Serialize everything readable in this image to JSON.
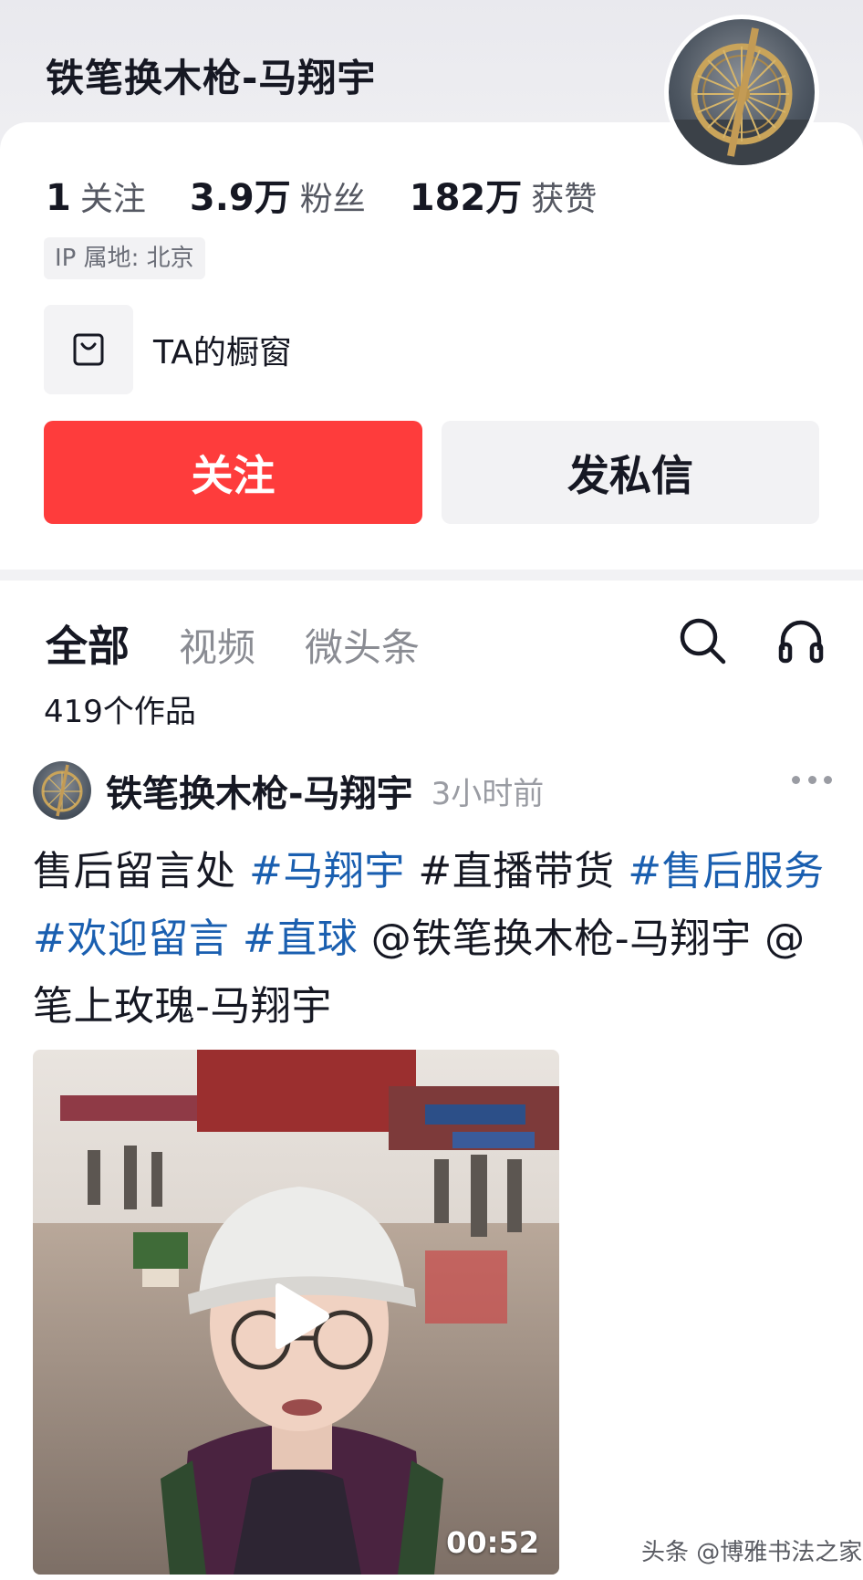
{
  "profile": {
    "username": "铁笔换木枪-马翔宇",
    "avatar_icon": "bicycle-wheel-avatar",
    "stats": [
      {
        "num": "1",
        "label": "关注"
      },
      {
        "num": "3.9万",
        "label": "粉丝"
      },
      {
        "num": "182万",
        "label": "获赞"
      }
    ],
    "ip_location": "IP 属地: 北京",
    "shop_label": "TA的橱窗",
    "shop_icon": "shopping-bag-icon",
    "follow_label": "关注",
    "message_label": "发私信",
    "accent_color": "#fe3c3c"
  },
  "tabs": {
    "items": [
      {
        "label": "全部",
        "active": true
      },
      {
        "label": "视频",
        "active": false
      },
      {
        "label": "微头条",
        "active": false
      }
    ],
    "search_icon": "search-icon",
    "listen_icon": "headphones-icon"
  },
  "works_count": "419个作品",
  "post": {
    "author": "铁笔换木枪-马翔宇",
    "time": "3小时前",
    "more_icon": "more-dots-icon",
    "text_parts": [
      {
        "text": "售后留言处 ",
        "tag": false
      },
      {
        "text": "#马翔宇",
        "tag": true
      },
      {
        "text": " #直播带货 ",
        "tag": false
      },
      {
        "text": "#售后服务",
        "tag": true
      },
      {
        "text": " ",
        "tag": false
      },
      {
        "text": "#欢迎留言",
        "tag": true
      },
      {
        "text": " ",
        "tag": false
      },
      {
        "text": "#直球",
        "tag": true
      },
      {
        "text": " @铁笔换木枪-马翔宇 @笔上玫瑰-马翔宇",
        "tag": false
      }
    ],
    "tag_color": "#1a5fb0",
    "video_duration": "00:52",
    "play_icon": "play-icon"
  },
  "watermark": "头条 @博雅书法之家"
}
